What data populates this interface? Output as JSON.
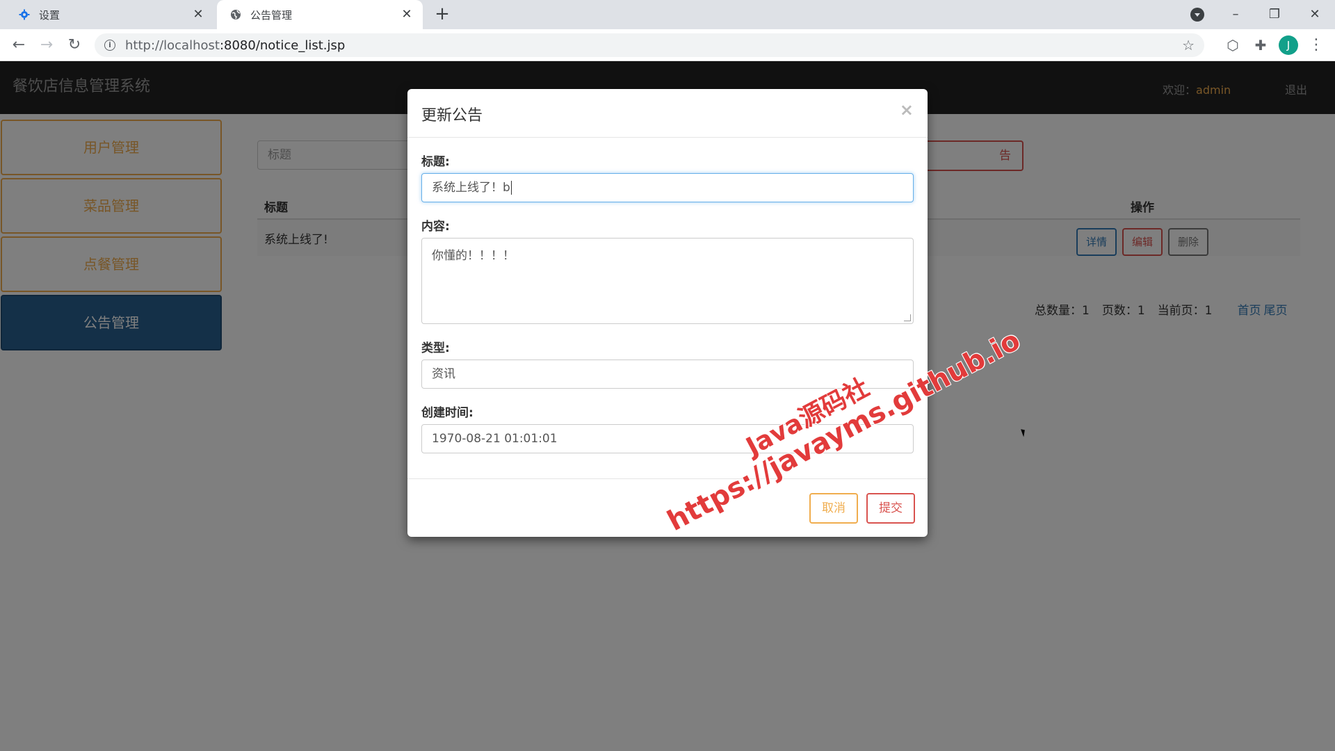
{
  "browser": {
    "tabs": [
      {
        "label": "设置",
        "icon": "gear-icon",
        "active": false
      },
      {
        "label": "公告管理",
        "icon": "globe-icon",
        "active": true
      }
    ],
    "url_host": "http://localhost",
    "url_rest": ":8080/notice_list.jsp",
    "avatar_letter": "J"
  },
  "header": {
    "brand": "餐饮店信息管理系统",
    "welcome_label": "欢迎：",
    "username": "admin",
    "logout": "退出"
  },
  "sidebar": {
    "items": [
      {
        "label": "用户管理",
        "active": false
      },
      {
        "label": "菜品管理",
        "active": false
      },
      {
        "label": "点餐管理",
        "active": false
      },
      {
        "label": "公告管理",
        "active": true
      }
    ]
  },
  "main": {
    "search_placeholder": "标题",
    "add_button": "告",
    "columns": {
      "title": "标题",
      "ops": "操作"
    },
    "rows": [
      {
        "title": "系统上线了!",
        "detail": "详情",
        "edit": "编辑",
        "delete": "删除"
      }
    ],
    "pager": {
      "total": "总数量：1",
      "pages": "页数：1",
      "current": "当前页：1",
      "first": "首页",
      "last": "尾页"
    }
  },
  "modal": {
    "title": "更新公告",
    "close": "×",
    "fields": {
      "title_label": "标题:",
      "title_value": "系统上线了！b",
      "content_label": "内容:",
      "content_value": "你懂的！！！！",
      "type_label": "类型:",
      "type_value": "资讯",
      "created_label": "创建时间:",
      "created_value": "1970-08-21 01:01:01"
    },
    "cancel": "取消",
    "submit": "提交"
  },
  "watermark": {
    "line1": "Java源码社",
    "line2": "https://javayms.github.io"
  },
  "colors": {
    "warning": "#f0ad4e",
    "danger": "#d9534f",
    "primary": "#337ab7",
    "active_nav": "#286090",
    "header_bg": "#222222"
  }
}
